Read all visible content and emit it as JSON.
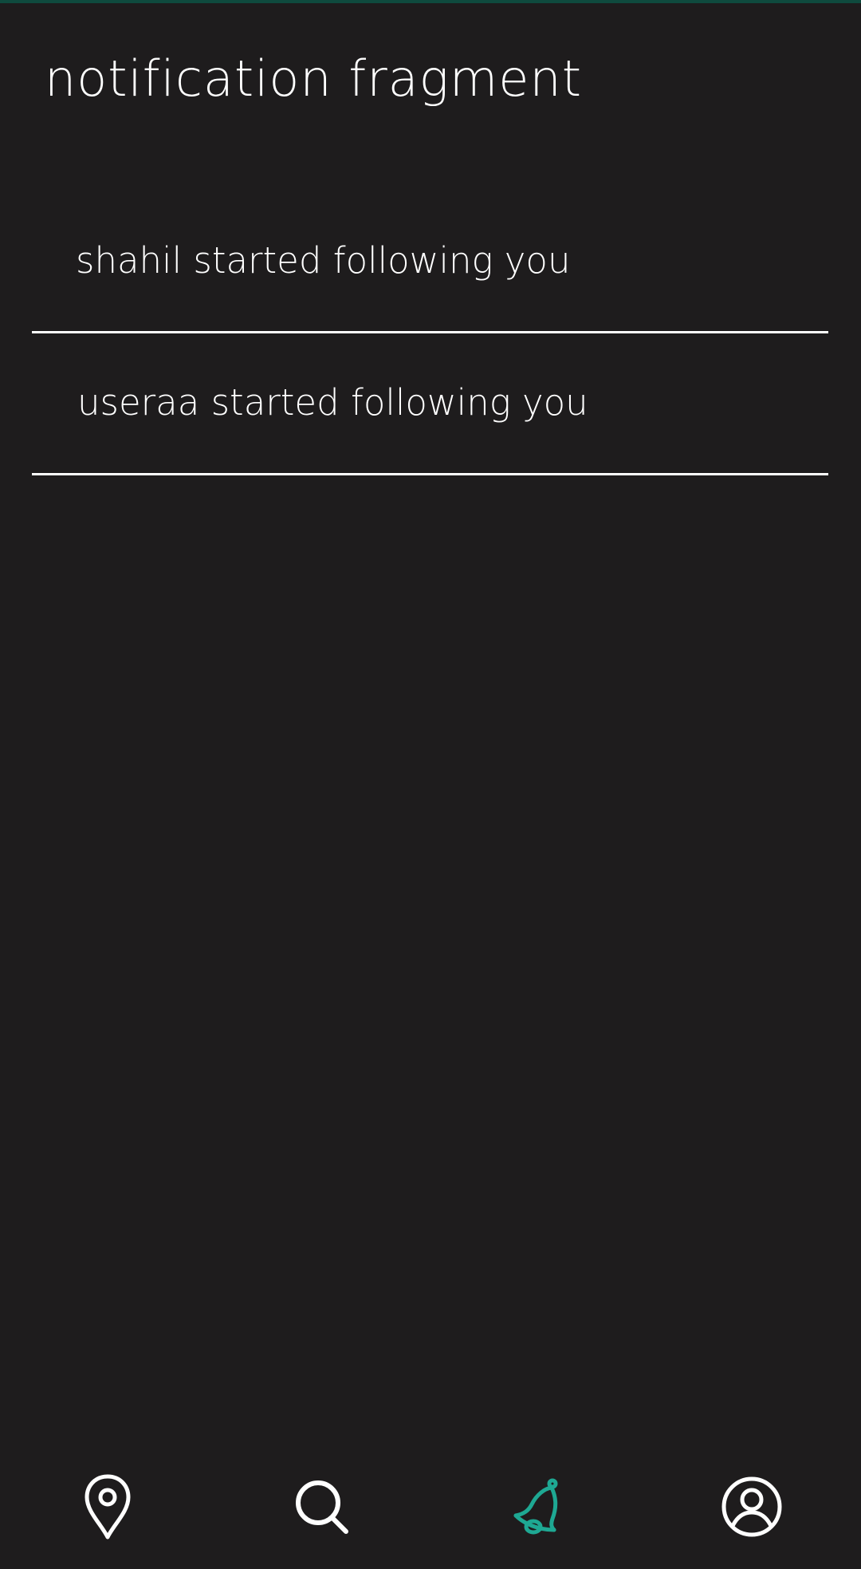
{
  "header": {
    "title": "notification fragment"
  },
  "notifications": [
    {
      "text": "shahil started following you"
    },
    {
      "text": "useraa started following you"
    }
  ],
  "bottom_nav": {
    "items": [
      {
        "icon": "map-pin-icon",
        "active": false
      },
      {
        "icon": "search-icon",
        "active": false
      },
      {
        "icon": "bell-icon",
        "active": true
      },
      {
        "icon": "profile-icon",
        "active": false
      }
    ]
  },
  "colors": {
    "background": "#1e1c1d",
    "text": "#ffffff",
    "accent": "#1ea893",
    "top_bar": "#0f4a3e"
  }
}
